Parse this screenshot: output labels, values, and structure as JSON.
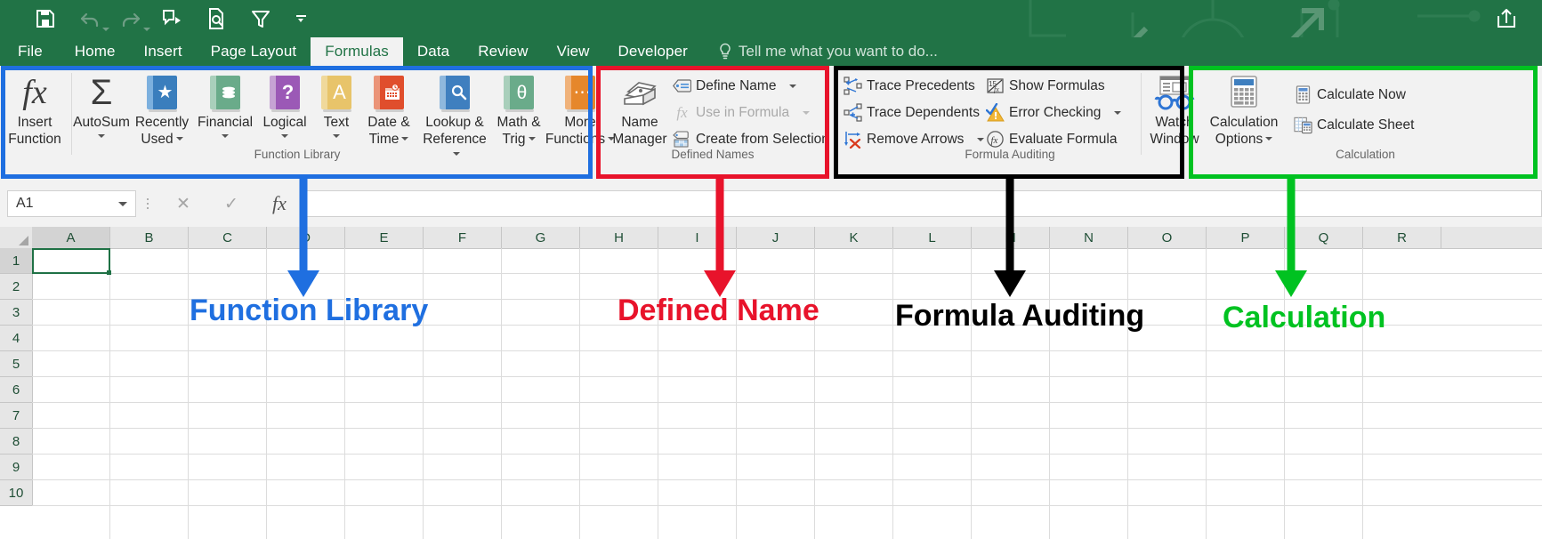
{
  "titlebar": {
    "quick_access": [
      {
        "name": "save",
        "label": "Save"
      },
      {
        "name": "undo",
        "label": "Undo"
      },
      {
        "name": "redo",
        "label": "Redo"
      },
      {
        "name": "touch-mode",
        "label": "Touch/Mouse Mode"
      },
      {
        "name": "print-preview",
        "label": "Print Preview and Print"
      },
      {
        "name": "filter",
        "label": "Filter"
      },
      {
        "name": "customize",
        "label": "Customize Quick Access Toolbar"
      }
    ],
    "share_label": "Share"
  },
  "tabs": [
    {
      "label": "File",
      "active": false
    },
    {
      "label": "Home",
      "active": false
    },
    {
      "label": "Insert",
      "active": false
    },
    {
      "label": "Page Layout",
      "active": false
    },
    {
      "label": "Formulas",
      "active": true
    },
    {
      "label": "Data",
      "active": false
    },
    {
      "label": "Review",
      "active": false
    },
    {
      "label": "View",
      "active": false
    },
    {
      "label": "Developer",
      "active": false
    }
  ],
  "tellme": {
    "placeholder": "Tell me what you want to do..."
  },
  "ribbon": {
    "groups": [
      {
        "name": "function-library",
        "label": "Function Library",
        "outline_color": "#1F6FE0",
        "buttons": [
          {
            "name": "insert-function",
            "line1": "Insert",
            "line2": "Function",
            "caret": false
          },
          {
            "name": "autosum",
            "line1": "AutoSum",
            "line2": "",
            "caret": true
          },
          {
            "name": "recently-used",
            "line1": "Recently",
            "line2": "Used",
            "caret": true
          },
          {
            "name": "financial",
            "line1": "Financial",
            "line2": "",
            "caret": true
          },
          {
            "name": "logical",
            "line1": "Logical",
            "line2": "",
            "caret": true
          },
          {
            "name": "text",
            "line1": "Text",
            "line2": "",
            "caret": true
          },
          {
            "name": "date-time",
            "line1": "Date &",
            "line2": "Time",
            "caret": true
          },
          {
            "name": "lookup-reference",
            "line1": "Lookup &",
            "line2": "Reference",
            "caret": true
          },
          {
            "name": "math-trig",
            "line1": "Math &",
            "line2": "Trig",
            "caret": true
          },
          {
            "name": "more-functions",
            "line1": "More",
            "line2": "Functions",
            "caret": true
          }
        ]
      },
      {
        "name": "defined-names",
        "label": "Defined Names",
        "outline_color": "#E8132B",
        "big_button": {
          "name": "name-manager",
          "line1": "Name",
          "line2": "Manager"
        },
        "items": [
          {
            "name": "define-name",
            "label": "Define Name",
            "caret": true,
            "disabled": false
          },
          {
            "name": "use-in-formula",
            "label": "Use in Formula",
            "caret": true,
            "disabled": true
          },
          {
            "name": "create-from-selection",
            "label": "Create from Selection",
            "caret": false,
            "disabled": false
          }
        ]
      },
      {
        "name": "formula-auditing",
        "label": "Formula Auditing",
        "outline_color": "#000000",
        "col1": [
          {
            "name": "trace-precedents",
            "label": "Trace Precedents",
            "caret": false
          },
          {
            "name": "trace-dependents",
            "label": "Trace Dependents",
            "caret": false
          },
          {
            "name": "remove-arrows",
            "label": "Remove Arrows",
            "caret": true
          }
        ],
        "col2": [
          {
            "name": "show-formulas",
            "label": "Show Formulas",
            "caret": false
          },
          {
            "name": "error-checking",
            "label": "Error Checking",
            "caret": true
          },
          {
            "name": "evaluate-formula",
            "label": "Evaluate Formula",
            "caret": false
          }
        ],
        "watch_window": {
          "name": "watch-window",
          "line1": "Watch",
          "line2": "Window"
        }
      },
      {
        "name": "calculation",
        "label": "Calculation",
        "outline_color": "#00C221",
        "big_button": {
          "name": "calculation-options",
          "line1": "Calculation",
          "line2": "Options"
        },
        "items": [
          {
            "name": "calculate-now",
            "label": "Calculate Now"
          },
          {
            "name": "calculate-sheet",
            "label": "Calculate Sheet"
          }
        ]
      }
    ]
  },
  "formulabar": {
    "namebox_value": "A1",
    "cancel_label": "✕",
    "enter_label": "✓",
    "fx_label": "fx",
    "formula_value": ""
  },
  "grid": {
    "columns": [
      "A",
      "B",
      "C",
      "D",
      "E",
      "F",
      "G",
      "H",
      "I",
      "J",
      "K",
      "L",
      "M",
      "N",
      "O",
      "P",
      "Q",
      "R"
    ],
    "rows": [
      "1",
      "2",
      "3",
      "4",
      "5",
      "6",
      "7",
      "8",
      "9",
      "10"
    ],
    "active_cell": "A1"
  },
  "annotations": [
    {
      "name": "annotation-function-library",
      "text": "Function Library",
      "color": "#1F6FE0"
    },
    {
      "name": "annotation-defined-name",
      "text": "Defined Name",
      "color": "#E8132B"
    },
    {
      "name": "annotation-formula-auditing",
      "text": "Formula Auditing",
      "color": "#000000"
    },
    {
      "name": "annotation-calculation",
      "text": "Calculation",
      "color": "#00C221"
    }
  ]
}
